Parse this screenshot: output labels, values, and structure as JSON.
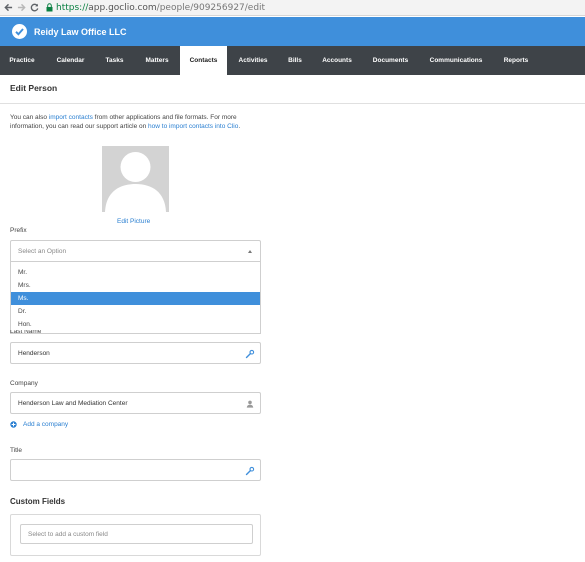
{
  "browser": {
    "url_scheme": "https://",
    "url_host": "app.goclio.com",
    "url_path": "/people/909256927/edit"
  },
  "app": {
    "title": "Reidy Law Office LLC",
    "accent_color": "#3f8fdb",
    "nav_bg_color": "#3e4348"
  },
  "nav": {
    "items": [
      {
        "label": "Practice"
      },
      {
        "label": "Calendar"
      },
      {
        "label": "Tasks"
      },
      {
        "label": "Matters"
      },
      {
        "label": "Contacts",
        "active": true
      },
      {
        "label": "Activities"
      },
      {
        "label": "Bills"
      },
      {
        "label": "Accounts"
      },
      {
        "label": "Documents"
      },
      {
        "label": "Communications"
      },
      {
        "label": "Reports"
      }
    ]
  },
  "page": {
    "title": "Edit Person",
    "intro": {
      "part1": "You can also ",
      "link1": "import contacts",
      "part2": " from other applications and file formats. For more information, you can read our support article on ",
      "link2": "how to import contacts into Clio",
      "part3": "."
    },
    "edit_picture": "Edit Picture"
  },
  "form": {
    "prefix": {
      "label": "Prefix",
      "placeholder": "Select an Option",
      "options": [
        "Mr.",
        "Mrs.",
        "Ms.",
        "Dr.",
        "Hon."
      ],
      "highlighted": "Ms."
    },
    "last_name": {
      "label": "Last Name",
      "value": "Henderson",
      "icon": "wrench-icon"
    },
    "company": {
      "label": "Company",
      "value": "Henderson Law and Mediation Center",
      "icon": "person-icon"
    },
    "add_company": "Add a company",
    "title_field": {
      "label": "Title",
      "value": "",
      "icon": "wrench-icon"
    }
  },
  "custom_fields": {
    "heading": "Custom Fields",
    "placeholder": "Select to add a custom field"
  }
}
